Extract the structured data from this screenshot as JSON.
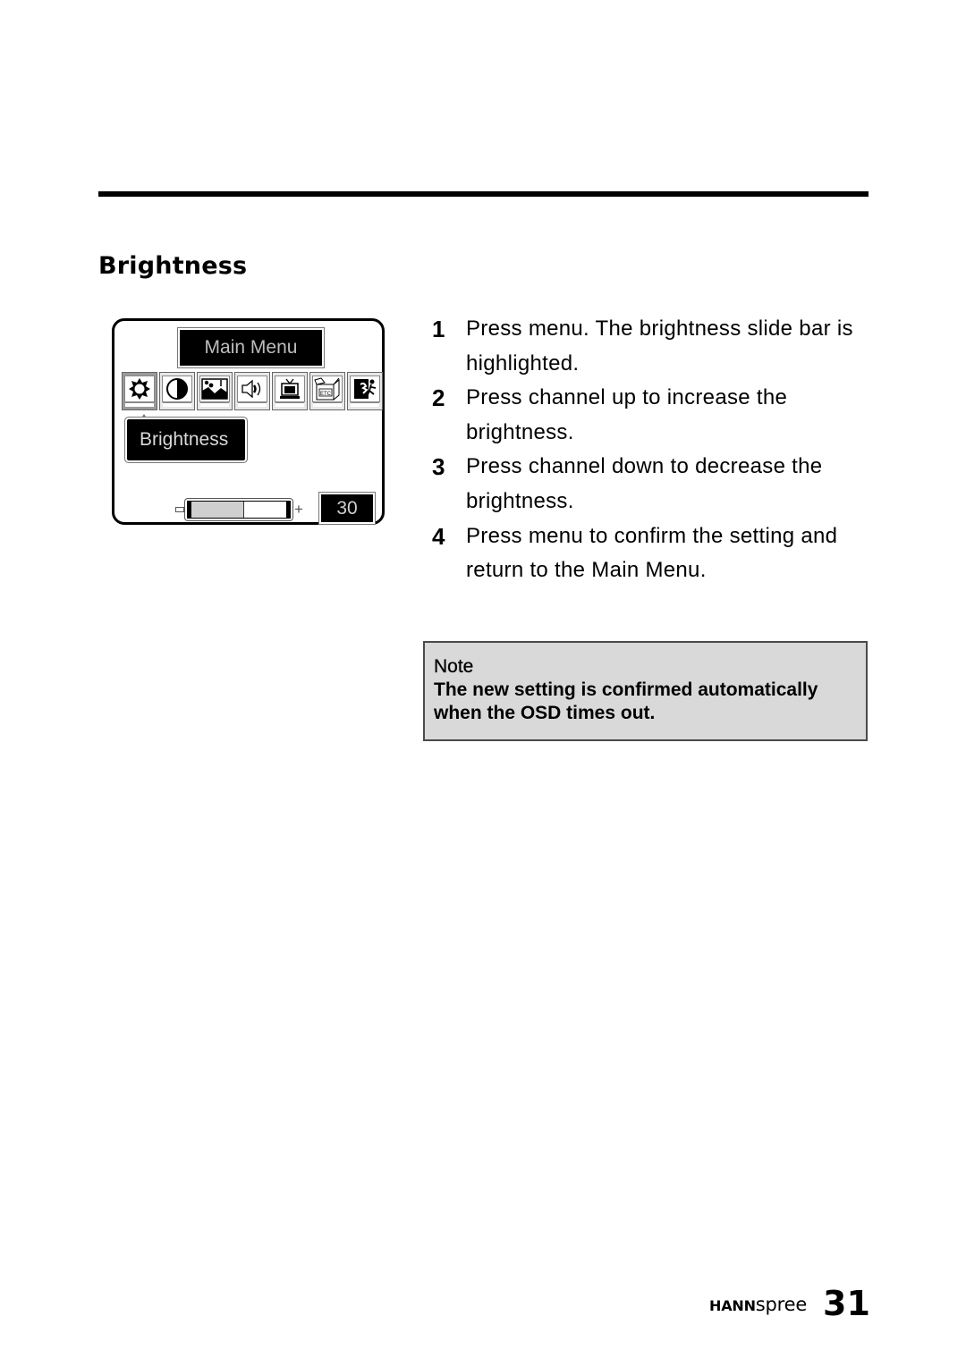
{
  "page": {
    "section_title": "Brightness",
    "page_number": "31",
    "brand": {
      "bold": "HANN",
      "light": "spree"
    }
  },
  "osd": {
    "title": "Main Menu",
    "icons": [
      {
        "name": "brightness-icon",
        "selected": true
      },
      {
        "name": "contrast-icon",
        "selected": false
      },
      {
        "name": "picture-icon",
        "selected": false
      },
      {
        "name": "audio-icon",
        "selected": false
      },
      {
        "name": "tv-icon",
        "selected": false
      },
      {
        "name": "etc-icon",
        "label": "ETC",
        "selected": false
      },
      {
        "name": "exit-icon",
        "selected": false
      }
    ],
    "selected_label": "Brightness",
    "slider": {
      "value": "30",
      "min_symbol": "−",
      "max_symbol": "+",
      "fill_fraction": 0.55
    }
  },
  "steps": [
    {
      "number": "1",
      "text": "Press menu. The brightness slide bar is highlighted."
    },
    {
      "number": "2",
      "text": "Press channel up to increase the brightness."
    },
    {
      "number": "3",
      "text": "Press channel down to decrease the brightness."
    },
    {
      "number": "4",
      "text": "Press menu to confirm the setting and return to the Main Menu."
    }
  ],
  "note": {
    "title": "Note",
    "text": "The new setting is confirmed automatically when the OSD times out."
  }
}
